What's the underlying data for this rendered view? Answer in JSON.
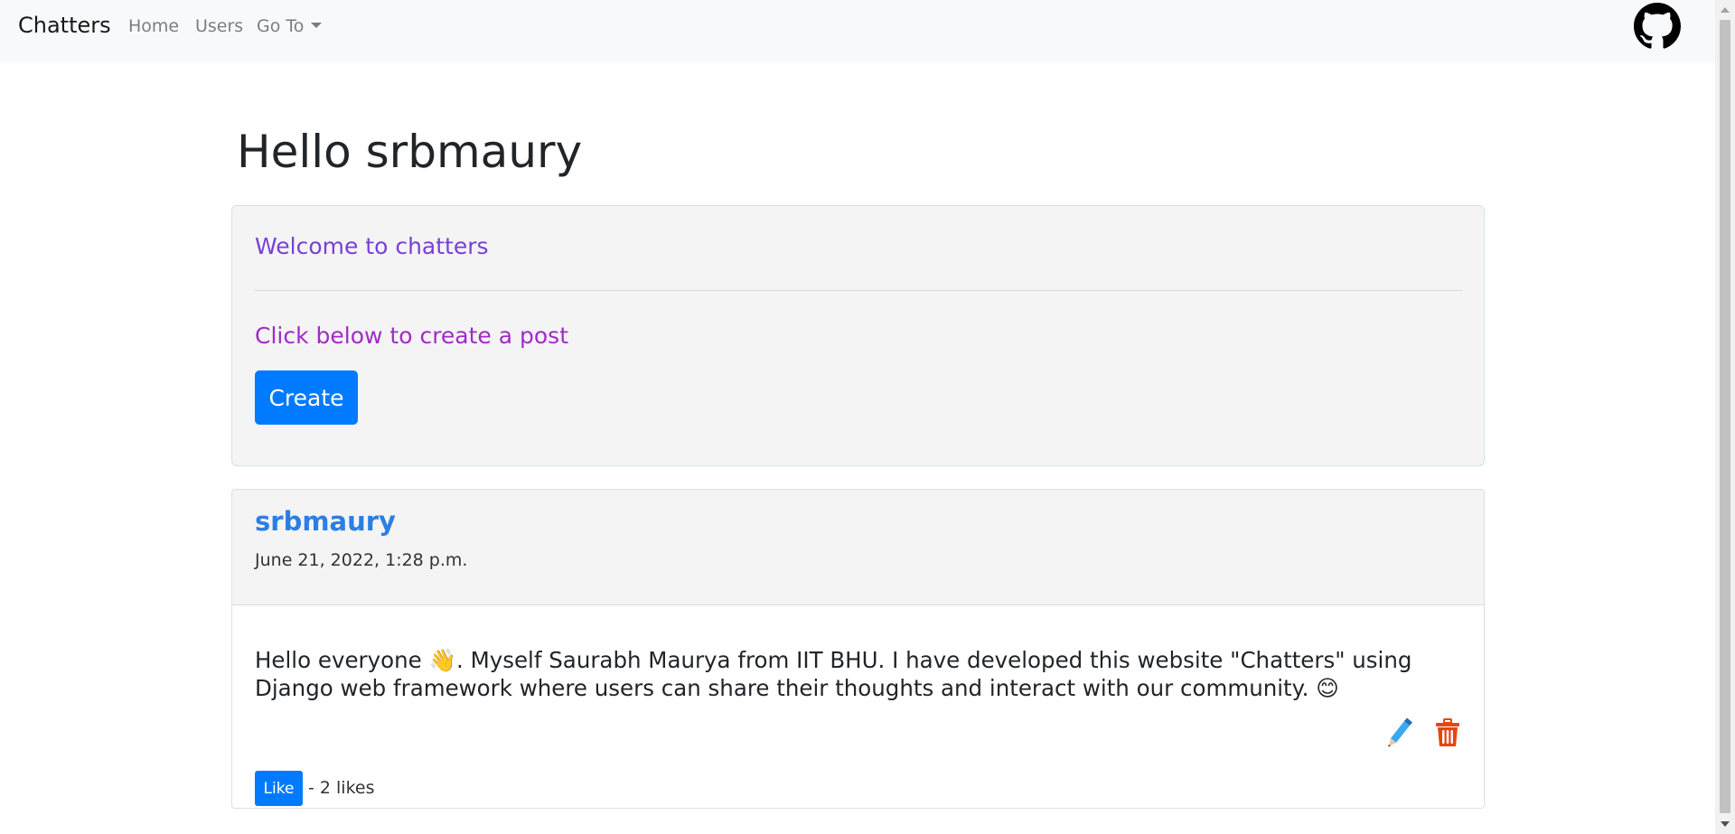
{
  "navbar": {
    "brand": "Chatters",
    "links": [
      {
        "label": "Home"
      },
      {
        "label": "Users"
      },
      {
        "label": "Go To"
      }
    ],
    "github_icon": "github-icon"
  },
  "page": {
    "greeting": "Hello srbmaury"
  },
  "welcome_card": {
    "title": "Welcome to chatters",
    "prompt": "Click below to create a post",
    "create_label": "Create"
  },
  "post": {
    "author": "srbmaury",
    "date": "June 21, 2022, 1:28 p.m.",
    "body": "Hello everyone 👋. Myself Saurabh Maurya from IIT BHU. I have developed this website \"Chatters\" using Django web framework where users can share their thoughts and interact with our community. 😊",
    "edit_icon": "pencil-icon",
    "delete_icon": "trash-icon",
    "like_label": "Like",
    "likes_text": "- 2 likes"
  },
  "colors": {
    "primary": "#007bff",
    "welcome_text": "#7a3fd6",
    "prompt_text": "#a12bc8",
    "author_link": "#2b7fe4",
    "delete_icon": "#e8440e",
    "edit_icon": "#3aa8f0"
  }
}
